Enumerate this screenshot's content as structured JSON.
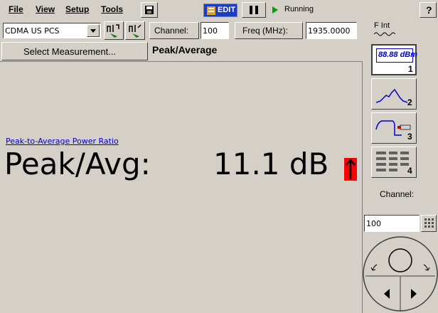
{
  "menu": {
    "file": "File",
    "view": "View",
    "setup": "Setup",
    "tools": "Tools"
  },
  "toolbar": {
    "edit_label": "EDIT",
    "status_text": "Running",
    "help_label": "?"
  },
  "controls": {
    "standard_value": "CDMA US PCS",
    "channel_button": "Channel:",
    "channel_value": "100",
    "freq_button": "Freq (MHz):",
    "freq_value": "1935.0000",
    "ref_indicator_line1": "F Int"
  },
  "measurement": {
    "select_button": "Select Measurement...",
    "title": "Peak/Average",
    "link_text": "Peak-to-Average Power Ratio",
    "label": "Peak/Avg:",
    "value": "11.1 dB"
  },
  "side_panel": {
    "display_button_1_text": "88.88 dBm",
    "display_button_1_num": "1",
    "display_button_2_num": "2",
    "display_button_3_num": "3",
    "display_button_4_num": "4",
    "channel_label": "Channel:",
    "channel_value": "100"
  },
  "colors": {
    "background": "#d4d0c8",
    "alert_red": "#ff0000",
    "link_blue": "#0000cc",
    "edit_bg": "#1a3dc8",
    "running_green": "#00a000"
  }
}
